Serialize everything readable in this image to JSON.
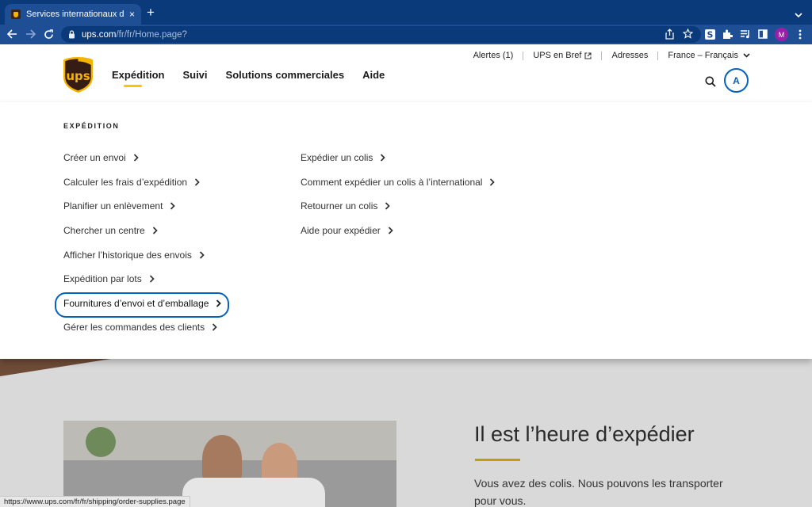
{
  "browser": {
    "tab_title": "Services internationaux d’expédition",
    "tab_close": "×",
    "new_tab": "+",
    "url_host": "ups.com",
    "url_path": "/fr/fr/Home.page?",
    "status_url": "https://www.ups.com/fr/fr/shipping/order-supplies.page",
    "profile_initial": "M"
  },
  "header": {
    "logo_text": "ups",
    "utility": {
      "alerts": "Alertes (1)",
      "brief": "UPS en Bref",
      "addresses": "Adresses",
      "locale": "France – Français"
    },
    "nav": [
      "Expédition",
      "Suivi",
      "Solutions commerciales",
      "Aide"
    ],
    "account_initial": "A"
  },
  "mega_menu": {
    "title": "EXPÉDITION",
    "column1": [
      "Créer un envoi",
      "Calculer les frais d’expédition",
      "Planifier un enlèvement",
      "Chercher un centre",
      "Afficher l’historique des envois",
      "Expédition par lots",
      "Fournitures d’envoi et d’emballage",
      "Gérer les commandes des clients"
    ],
    "column2": [
      "Expédier un colis",
      "Comment expédier un colis à l’international",
      "Retourner un colis",
      "Aide pour expédier"
    ]
  },
  "hero": {
    "title": "Il est l’heure d’expédier",
    "text": "Vous avez des colis. Nous pouvons les transporter pour vous."
  },
  "colors": {
    "ups_brown": "#351c15",
    "ups_gold": "#ffc400",
    "link_blue": "#0662bb",
    "chrome_blue": "#1e4f94"
  }
}
